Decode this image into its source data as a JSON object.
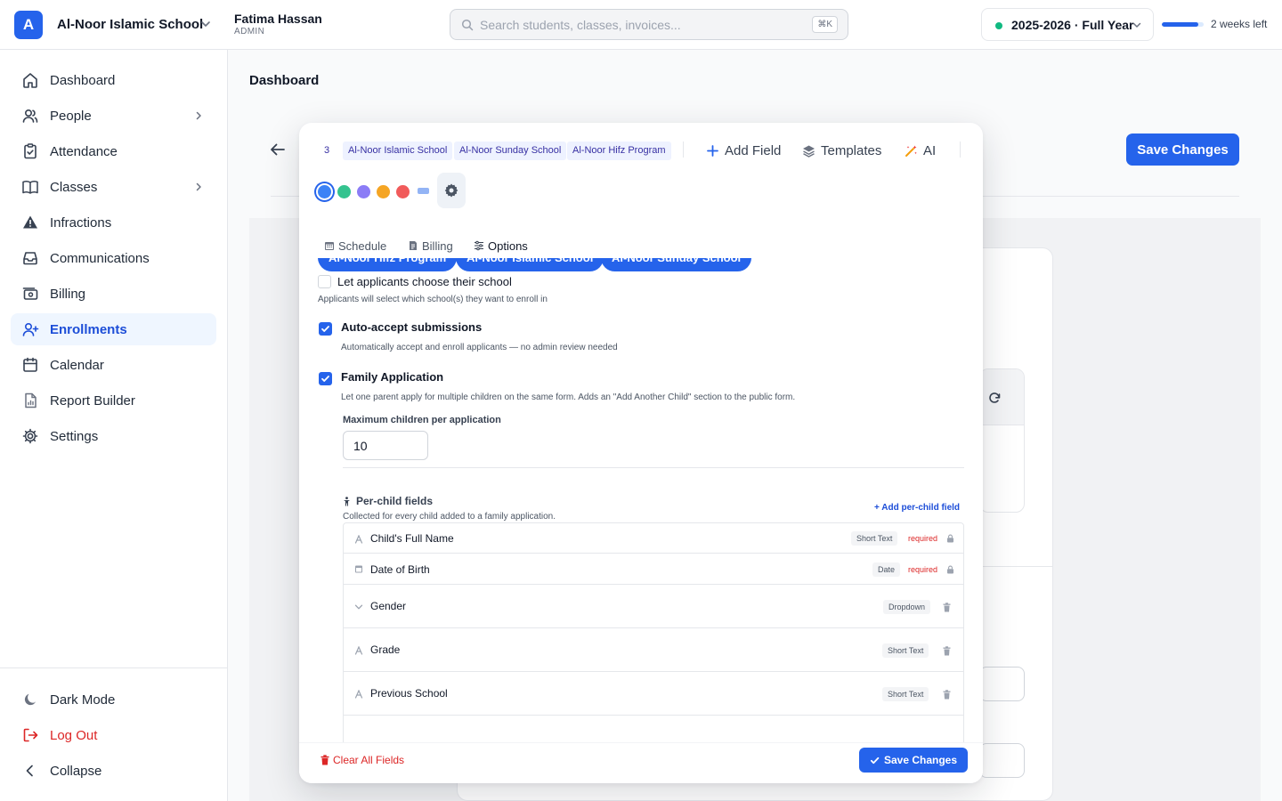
{
  "app": {
    "logo_letter": "A",
    "school_name": "Al-Noor Islamic School",
    "user_name": "Fatima Hassan",
    "user_role": "ADMIN",
    "search_placeholder": "Search students, classes, invoices...",
    "search_shortcut": "⌘K",
    "school_year": "2025-2026 · Full Year",
    "year_progress_fraction": 0.87,
    "time_left": "2 weeks left",
    "accent": "#2563eb"
  },
  "sidebar": {
    "items": [
      {
        "label": "Dashboard",
        "icon": "home-icon"
      },
      {
        "label": "People",
        "icon": "users-icon",
        "chevron": true
      },
      {
        "label": "Attendance",
        "icon": "clipboard-check-icon"
      },
      {
        "label": "Classes",
        "icon": "book-open-icon",
        "chevron": true
      },
      {
        "label": "Infractions",
        "icon": "alert-triangle-icon"
      },
      {
        "label": "Communications",
        "icon": "inbox-icon"
      },
      {
        "label": "Billing",
        "icon": "billing-icon"
      },
      {
        "label": "Enrollments",
        "icon": "user-plus-icon",
        "active": true
      },
      {
        "label": "Calendar",
        "icon": "calendar-icon"
      },
      {
        "label": "Report Builder",
        "icon": "report-icon"
      },
      {
        "label": "Settings",
        "icon": "gear-icon"
      }
    ],
    "bottom": {
      "dark_mode": "Dark Mode",
      "logout": "Log Out",
      "collapse": "Collapse"
    }
  },
  "page": {
    "breadcrumb": "Dashboard",
    "save_label": "Save Changes"
  },
  "modal": {
    "school_count": "3",
    "schools": [
      "Al-Noor Islamic School",
      "Al-Noor Sunday School",
      "Al-Noor Hifz Program"
    ],
    "toolbar": {
      "add_field": "Add Field",
      "templates": "Templates",
      "ai": "AI"
    },
    "theme_colors": [
      "#3b82f6",
      "#34c38f",
      "#8b7cf6",
      "#f5a524",
      "#f15b5b"
    ],
    "tabs": {
      "schedule": "Schedule",
      "billing": "Billing",
      "options": "Options"
    },
    "school_pills": [
      "Al-Noor Hifz Program",
      "Al-Noor Islamic School",
      "Al-Noor Sunday School"
    ],
    "options": {
      "choose_school": {
        "label": "Let applicants choose their school",
        "desc": "Applicants will select which school(s) they want to enroll in",
        "checked": false
      },
      "auto_accept": {
        "label": "Auto-accept submissions",
        "desc": "Automatically accept and enroll applicants — no admin review needed",
        "checked": true
      },
      "family_app": {
        "label": "Family Application",
        "desc": "Let one parent apply for multiple children on the same form. Adds an \"Add Another Child\" section to the public form.",
        "checked": true
      },
      "max_children_label": "Maximum children per application",
      "max_children_value": "10"
    },
    "per_child": {
      "title": "Per-child fields",
      "desc": "Collected for every child added to a family application.",
      "add_label": "+ Add per-child field",
      "required_text": "required",
      "rows": [
        {
          "label": "Child's Full Name",
          "type": "Short Text",
          "icon": "text-type-icon",
          "locked": true
        },
        {
          "label": "Date of Birth",
          "type": "Date",
          "icon": "calendar-small-icon",
          "locked": true
        },
        {
          "label": "Gender",
          "type": "Dropdown",
          "icon": "chevron-down-icon",
          "locked": false
        },
        {
          "label": "Grade",
          "type": "Short Text",
          "icon": "text-type-icon",
          "locked": false
        },
        {
          "label": "Previous School",
          "type": "Short Text",
          "icon": "text-type-icon",
          "locked": false
        }
      ]
    },
    "footer": {
      "clear": "Clear All Fields",
      "save": "Save Changes"
    }
  }
}
